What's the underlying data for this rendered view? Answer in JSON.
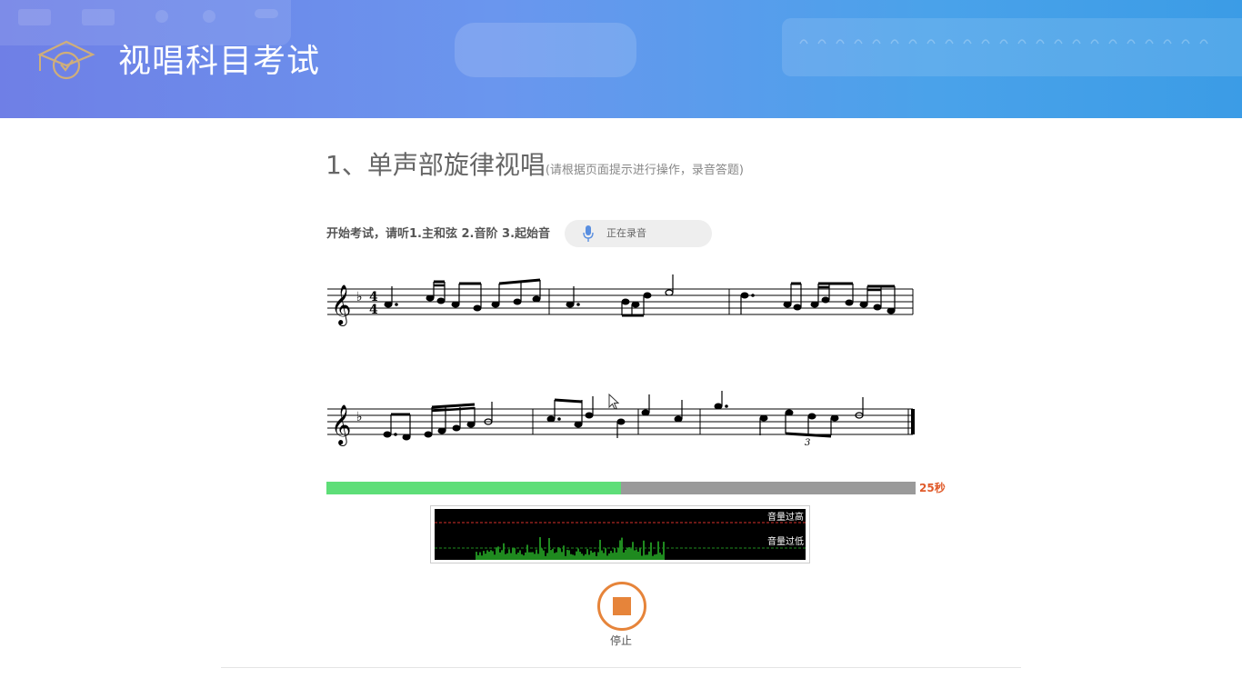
{
  "header": {
    "title": "视唱科目考试",
    "logo_icon": "graduation-cap-clock-icon",
    "background": "#6a96ee"
  },
  "question": {
    "title": "1、单声部旋律视唱",
    "hint": "(请根据页面提示进行操作，录音答题)"
  },
  "instruction": "开始考试，请听1.主和弦 2.音阶 3.起始音",
  "recording": {
    "status_label": "正在录音",
    "icon": "microphone-icon"
  },
  "score": {
    "clef": "treble",
    "key_signature": "F major (1 flat)",
    "time_signature": "4/4"
  },
  "progress": {
    "fraction": 0.5,
    "remaining_label": "25秒",
    "fill_color": "#5ede78",
    "track_color": "#9a9a9a"
  },
  "meter": {
    "high_label": "音量过高",
    "low_label": "音量过低",
    "wave_color": "#1f8a1f"
  },
  "stop": {
    "label": "停止",
    "color": "#e6843a"
  }
}
